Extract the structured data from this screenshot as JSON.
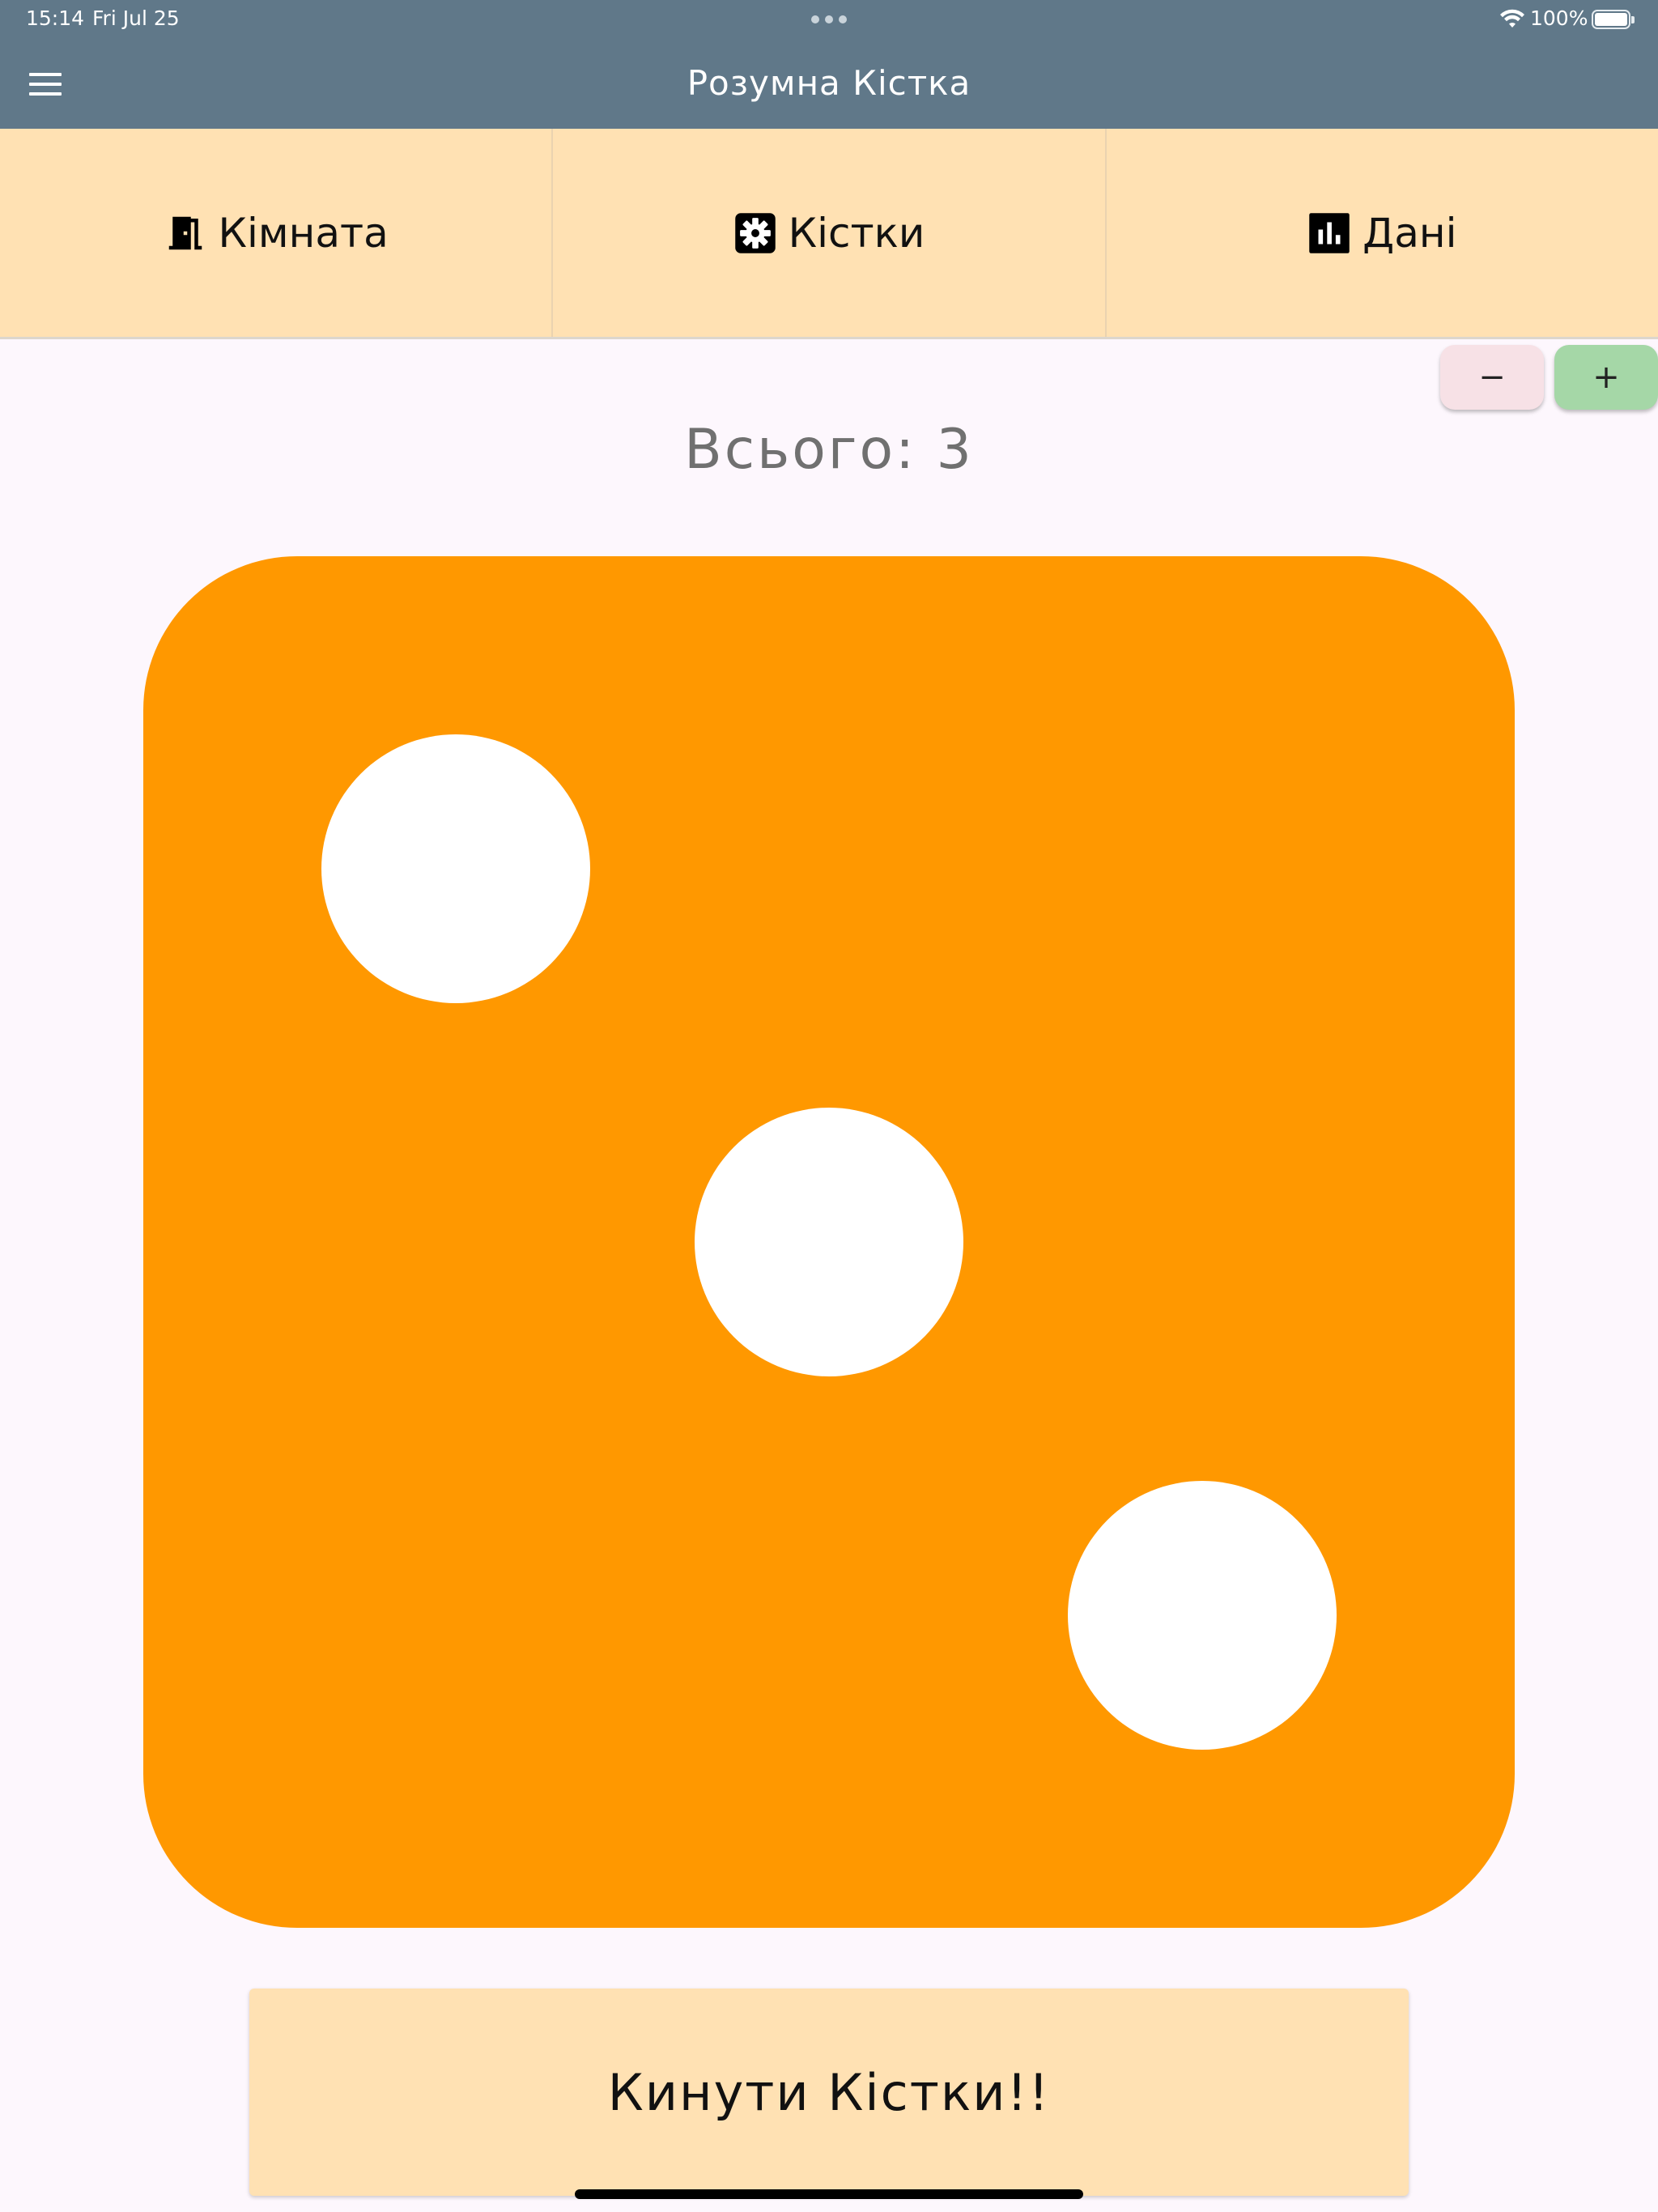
{
  "status_bar": {
    "time": "15:14",
    "date": "Fri Jul 25",
    "battery": "100%"
  },
  "app_bar": {
    "title": "Розумна Кістка",
    "menu_icon": "hamburger-menu-icon",
    "background_color": "#607889"
  },
  "tabs": [
    {
      "label": "Кімната",
      "icon": "door-icon"
    },
    {
      "label": "Кістки",
      "icon": "gear-icon"
    },
    {
      "label": "Дані",
      "icon": "bar-chart-icon"
    }
  ],
  "stepper": {
    "minus_label": "−",
    "plus_label": "+"
  },
  "total": {
    "label": "Всього: 3",
    "value": 3
  },
  "die": {
    "face_value": 3,
    "color": "#ff9800",
    "pip_color": "#ffffff"
  },
  "roll_button": {
    "label": "Кинути Кістки!!"
  },
  "accent_colors": {
    "tab_background": "#ffe1b3",
    "minus_button": "#f7e1e6",
    "plus_button": "#a5d7a7"
  }
}
